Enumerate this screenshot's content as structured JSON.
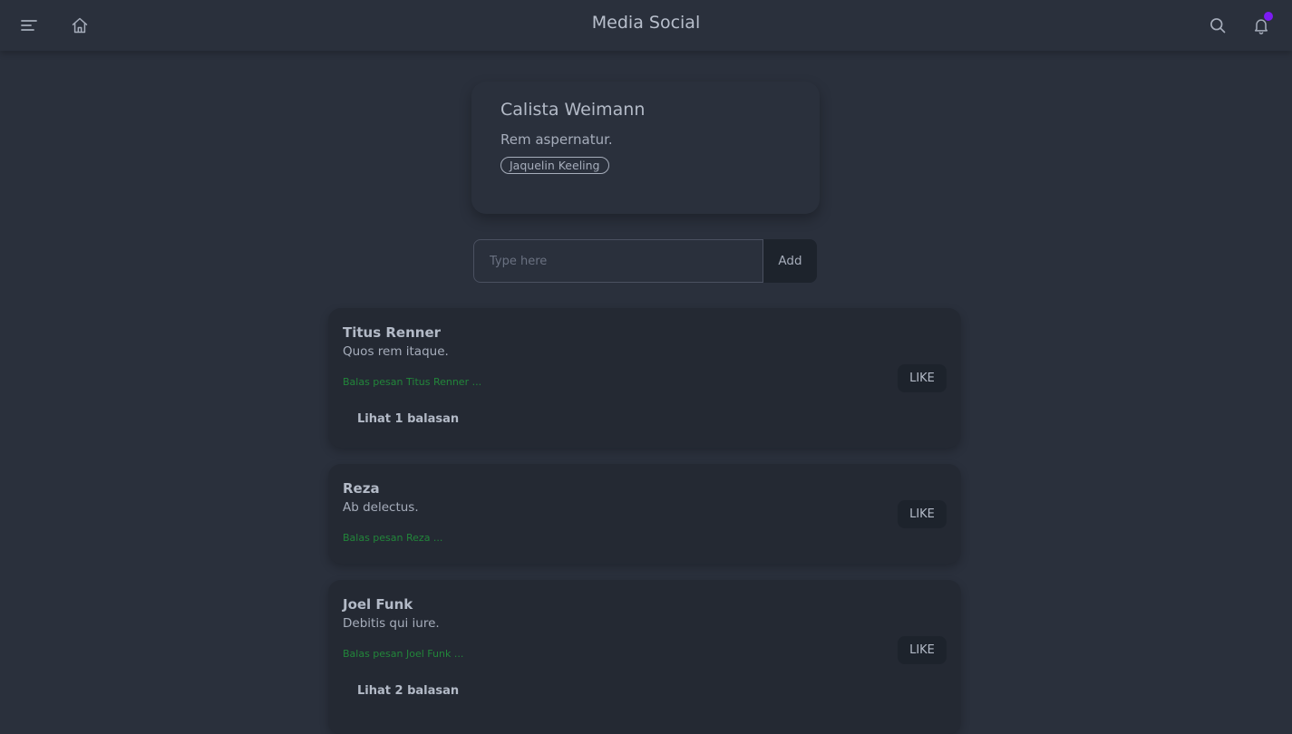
{
  "navbar": {
    "title": "Media Social",
    "menu_icon": "menu-icon",
    "home_icon": "home-icon",
    "search_icon": "search-icon",
    "bell_icon": "bell-icon",
    "notification_dot_color": "#7c1bf2"
  },
  "post": {
    "author": "Calista Weimann",
    "text": "Rem aspernatur.",
    "tag": "Jaquelin Keeling"
  },
  "comment_form": {
    "placeholder": "Type here",
    "button_label": "Add"
  },
  "comments": [
    {
      "author": "Titus Renner",
      "text": "Quos rem itaque.",
      "reply_link": "Balas pesan Titus Renner ...",
      "replies_label": "Lihat 1 balasan",
      "like_label": "LIKE"
    },
    {
      "author": "Reza",
      "text": "Ab delectus.",
      "reply_link": "Balas pesan Reza ...",
      "replies_label": "",
      "like_label": "LIKE"
    },
    {
      "author": "Joel Funk",
      "text": "Debitis qui iure.",
      "reply_link": "Balas pesan Joel Funk ...",
      "replies_label": "Lihat 2 balasan",
      "like_label": "LIKE"
    }
  ],
  "colors": {
    "background": "#2a303c",
    "card": "#242933",
    "button": "#1d232c",
    "reply_link": "#22863a",
    "accent": "#7c1bf2"
  }
}
